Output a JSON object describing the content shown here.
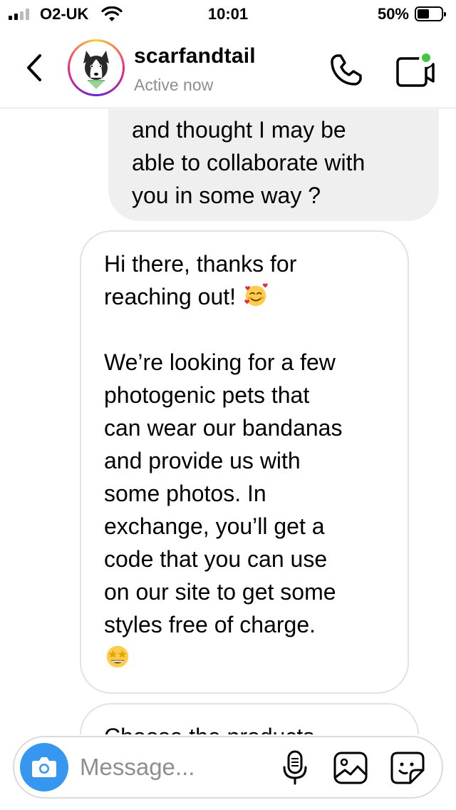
{
  "status_bar": {
    "carrier": "O2-UK",
    "time": "10:01",
    "battery_percent": "50%",
    "battery_level": 0.5,
    "signal_bars": 2
  },
  "header": {
    "contact_name": "scarfandtail",
    "contact_status": "Active now",
    "video_indicator_color": "#44c63e"
  },
  "messages": {
    "outgoing_partial": "and thought I may be\nable to collaborate with\nyou in some way ?",
    "incoming_1_line1": "Hi there, thanks for\nreaching out! ",
    "incoming_1_body": "We’re looking for a few\nphotogenic pets that\ncan wear our bandanas\nand provide us with\nsome photos. In\nexchange, you’ll get a\ncode that you can use\non our site to get some\nstyles free of charge.",
    "incoming_2_partial": "Choose the products"
  },
  "composer": {
    "placeholder": "Message...",
    "accent_color": "#3797f0"
  },
  "icons": {
    "back": "chevron-left-icon",
    "call": "phone-icon",
    "video": "video-camera-icon",
    "camera": "camera-icon",
    "mic": "microphone-icon",
    "gallery": "image-icon",
    "sticker": "sticker-icon"
  }
}
